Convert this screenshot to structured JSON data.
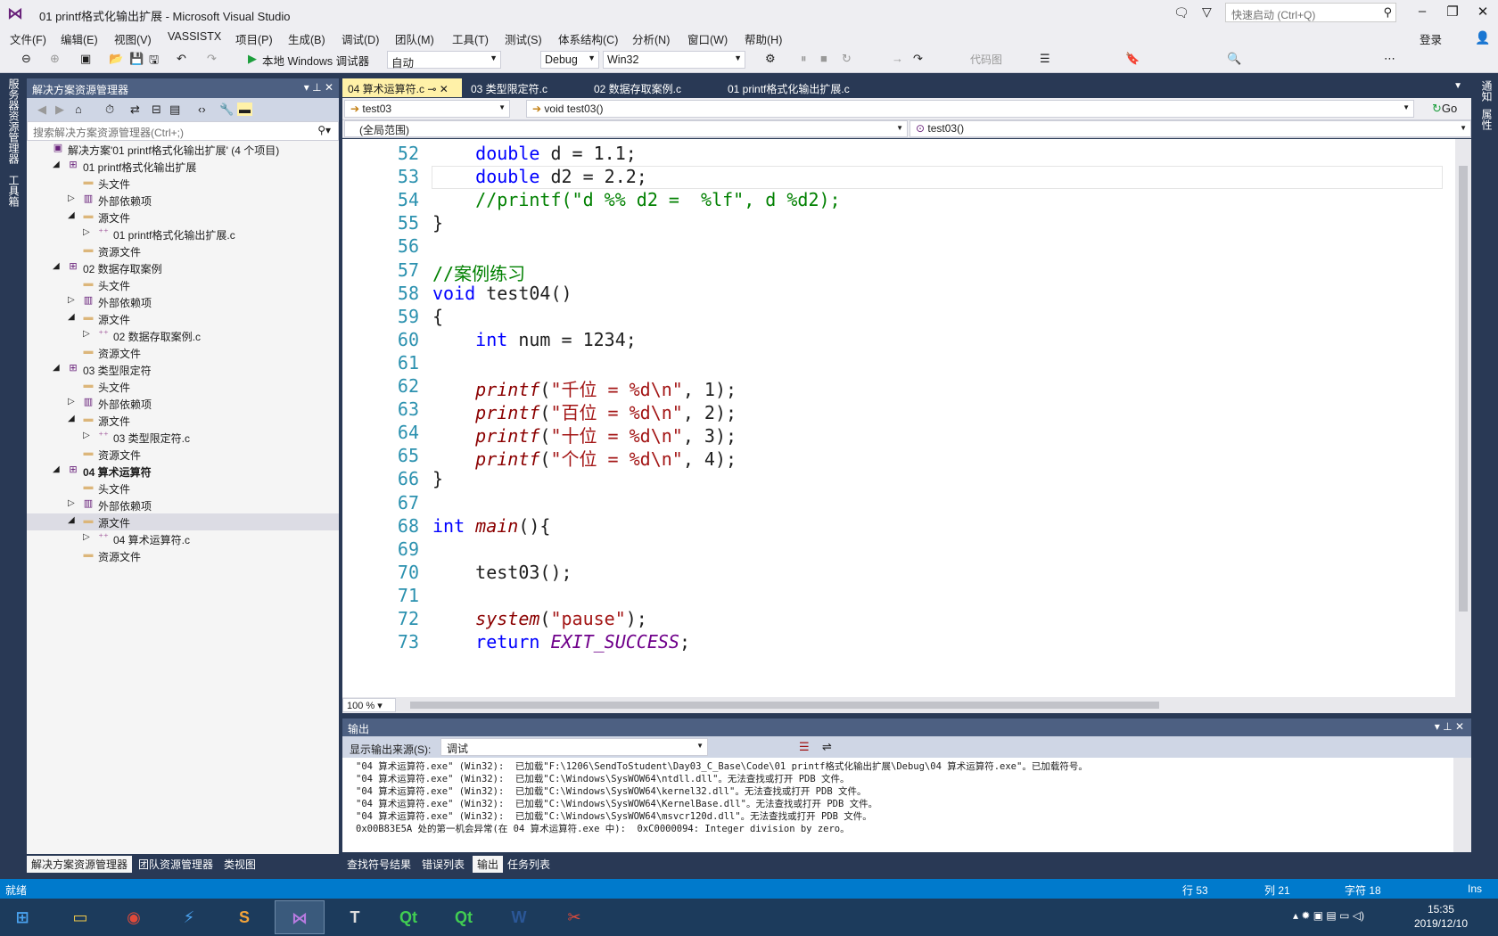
{
  "window": {
    "title": "01 printf格式化输出扩展 - Microsoft Visual Studio",
    "quick_launch": "快速启动 (Ctrl+Q)",
    "sign_in": "登录"
  },
  "menu": [
    "文件(F)",
    "编辑(E)",
    "视图(V)",
    "VASSISTX",
    "项目(P)",
    "生成(B)",
    "调试(D)",
    "团队(M)",
    "工具(T)",
    "测试(S)",
    "体系结构(C)",
    "分析(N)",
    "窗口(W)",
    "帮助(H)"
  ],
  "toolbar": {
    "debugger": "本地 Windows 调试器",
    "auto": "自动",
    "config": "Debug",
    "platform": "Win32",
    "code_map": "代码图"
  },
  "side_tabs_left": [
    "服务器资源管理器",
    "工具箱"
  ],
  "side_tabs_right": [
    "通知",
    "属性"
  ],
  "solution": {
    "header": "解决方案资源管理器",
    "search_placeholder": "搜索解决方案资源管理器(Ctrl+;)",
    "tree": [
      {
        "label": "解决方案'01 printf格式化输出扩展' (4 个项目)",
        "level": 0,
        "icon": "solution-icon",
        "expand": ""
      },
      {
        "label": "01 printf格式化输出扩展",
        "level": 1,
        "icon": "project-icon",
        "expand": "◢"
      },
      {
        "label": "头文件",
        "level": 2,
        "icon": "folder-icon",
        "expand": ""
      },
      {
        "label": "外部依赖项",
        "level": 2,
        "icon": "dependencies-icon",
        "expand": "▷"
      },
      {
        "label": "源文件",
        "level": 2,
        "icon": "folder-icon",
        "expand": "◢"
      },
      {
        "label": "01 printf格式化输出扩展.c",
        "level": 3,
        "icon": "c-file-icon",
        "expand": "▷"
      },
      {
        "label": "资源文件",
        "level": 2,
        "icon": "folder-icon",
        "expand": ""
      },
      {
        "label": "02 数据存取案例",
        "level": 1,
        "icon": "project-icon",
        "expand": "◢"
      },
      {
        "label": "头文件",
        "level": 2,
        "icon": "folder-icon",
        "expand": ""
      },
      {
        "label": "外部依赖项",
        "level": 2,
        "icon": "dependencies-icon",
        "expand": "▷"
      },
      {
        "label": "源文件",
        "level": 2,
        "icon": "folder-icon",
        "expand": "◢"
      },
      {
        "label": "02 数据存取案例.c",
        "level": 3,
        "icon": "c-file-icon",
        "expand": "▷"
      },
      {
        "label": "资源文件",
        "level": 2,
        "icon": "folder-icon",
        "expand": ""
      },
      {
        "label": "03 类型限定符",
        "level": 1,
        "icon": "project-icon",
        "expand": "◢"
      },
      {
        "label": "头文件",
        "level": 2,
        "icon": "folder-icon",
        "expand": ""
      },
      {
        "label": "外部依赖项",
        "level": 2,
        "icon": "dependencies-icon",
        "expand": "▷"
      },
      {
        "label": "源文件",
        "level": 2,
        "icon": "folder-icon",
        "expand": "◢"
      },
      {
        "label": "03 类型限定符.c",
        "level": 3,
        "icon": "c-file-icon",
        "expand": "▷"
      },
      {
        "label": "资源文件",
        "level": 2,
        "icon": "folder-icon",
        "expand": ""
      },
      {
        "label": "04 算术运算符",
        "level": 1,
        "icon": "project-icon",
        "expand": "◢",
        "bold": true
      },
      {
        "label": "头文件",
        "level": 2,
        "icon": "folder-icon",
        "expand": ""
      },
      {
        "label": "外部依赖项",
        "level": 2,
        "icon": "dependencies-icon",
        "expand": "▷"
      },
      {
        "label": "源文件",
        "level": 2,
        "icon": "folder-icon",
        "expand": "◢",
        "selected": true
      },
      {
        "label": "04 算术运算符.c",
        "level": 3,
        "icon": "c-file-icon",
        "expand": "▷"
      },
      {
        "label": "资源文件",
        "level": 2,
        "icon": "folder-icon",
        "expand": ""
      }
    ],
    "bottom_tabs": [
      "解决方案资源管理器",
      "团队资源管理器",
      "类视图"
    ]
  },
  "editor": {
    "tabs": [
      {
        "label": "04 算术运算符.c",
        "active": true
      },
      {
        "label": "03 类型限定符.c",
        "active": false
      },
      {
        "label": "02 数据存取案例.c",
        "active": false
      },
      {
        "label": "01 printf格式化输出扩展.c",
        "active": false
      }
    ],
    "nav_project": "test03",
    "nav_function": "void test03()",
    "go": "Go",
    "scope": "(全局范围)",
    "member": "test03()",
    "zoom": "100 %",
    "lines": [
      {
        "n": "52",
        "parts": [
          [
            "",
            "    "
          ],
          [
            "kw",
            "double"
          ],
          [
            "",
            " d = 1.1;"
          ]
        ]
      },
      {
        "n": "53",
        "parts": [
          [
            "",
            "    "
          ],
          [
            "kw",
            "double"
          ],
          [
            "",
            " d2 = 2.2;"
          ]
        ]
      },
      {
        "n": "54",
        "parts": [
          [
            "",
            "    "
          ],
          [
            "cm",
            "//printf(\"d %% d2 =  %lf\", d %d2);"
          ]
        ]
      },
      {
        "n": "55",
        "parts": [
          [
            "",
            "}"
          ]
        ]
      },
      {
        "n": "56",
        "parts": []
      },
      {
        "n": "57",
        "parts": [
          [
            "cm",
            "//案例练习"
          ]
        ]
      },
      {
        "n": "58",
        "parts": [
          [
            "kw",
            "void"
          ],
          [
            "",
            " test04()"
          ]
        ]
      },
      {
        "n": "59",
        "parts": [
          [
            "",
            "{"
          ]
        ]
      },
      {
        "n": "60",
        "parts": [
          [
            "",
            "    "
          ],
          [
            "kw",
            "int"
          ],
          [
            "",
            " num = 1234;"
          ]
        ]
      },
      {
        "n": "61",
        "parts": []
      },
      {
        "n": "62",
        "parts": [
          [
            "",
            "    "
          ],
          [
            "fn",
            "printf"
          ],
          [
            "",
            "("
          ],
          [
            "st",
            "\"千位 = %d\\n\""
          ],
          [
            "",
            ", 1);"
          ]
        ]
      },
      {
        "n": "63",
        "parts": [
          [
            "",
            "    "
          ],
          [
            "fn",
            "printf"
          ],
          [
            "",
            "("
          ],
          [
            "st",
            "\"百位 = %d\\n\""
          ],
          [
            "",
            ", 2);"
          ]
        ]
      },
      {
        "n": "64",
        "parts": [
          [
            "",
            "    "
          ],
          [
            "fn",
            "printf"
          ],
          [
            "",
            "("
          ],
          [
            "st",
            "\"十位 = %d\\n\""
          ],
          [
            "",
            ", 3);"
          ]
        ]
      },
      {
        "n": "65",
        "parts": [
          [
            "",
            "    "
          ],
          [
            "fn",
            "printf"
          ],
          [
            "",
            "("
          ],
          [
            "st",
            "\"个位 = %d\\n\""
          ],
          [
            "",
            ", 4);"
          ]
        ]
      },
      {
        "n": "66",
        "parts": [
          [
            "",
            "}"
          ]
        ]
      },
      {
        "n": "67",
        "parts": []
      },
      {
        "n": "68",
        "parts": [
          [
            "kw",
            "int"
          ],
          [
            "",
            " "
          ],
          [
            "fn",
            "main"
          ],
          [
            "",
            "(){"
          ]
        ]
      },
      {
        "n": "69",
        "parts": []
      },
      {
        "n": "70",
        "parts": [
          [
            "",
            "    test03();"
          ]
        ]
      },
      {
        "n": "71",
        "parts": []
      },
      {
        "n": "72",
        "parts": [
          [
            "",
            "    "
          ],
          [
            "fn",
            "system"
          ],
          [
            "",
            "("
          ],
          [
            "st",
            "\"pause\""
          ],
          [
            "",
            ");"
          ]
        ]
      },
      {
        "n": "73",
        "parts": [
          [
            "",
            "    "
          ],
          [
            "kw",
            "return"
          ],
          [
            "",
            " "
          ],
          [
            "mc",
            "EXIT_SUCCESS"
          ],
          [
            "",
            ";"
          ]
        ]
      }
    ]
  },
  "output": {
    "header": "输出",
    "source_label": "显示输出来源(S):",
    "source_value": "调试",
    "lines": [
      "\"04 算术运算符.exe\" (Win32):  已加载\"F:\\1206\\SendToStudent\\Day03_C_Base\\Code\\01 printf格式化输出扩展\\Debug\\04 算术运算符.exe\"。已加载符号。",
      "\"04 算术运算符.exe\" (Win32):  已加载\"C:\\Windows\\SysWOW64\\ntdll.dll\"。无法查找或打开 PDB 文件。",
      "\"04 算术运算符.exe\" (Win32):  已加载\"C:\\Windows\\SysWOW64\\kernel32.dll\"。无法查找或打开 PDB 文件。",
      "\"04 算术运算符.exe\" (Win32):  已加载\"C:\\Windows\\SysWOW64\\KernelBase.dll\"。无法查找或打开 PDB 文件。",
      "\"04 算术运算符.exe\" (Win32):  已加载\"C:\\Windows\\SysWOW64\\msvcr120d.dll\"。无法查找或打开 PDB 文件。",
      "0x00B83E5A 处的第一机会异常(在 04 算术运算符.exe 中):  0xC0000094: Integer division by zero。"
    ]
  },
  "bottom_tabs": [
    "查找符号结果",
    "错误列表",
    "输出",
    "任务列表"
  ],
  "status": {
    "ready": "就绪",
    "line": "行 53",
    "col": "列 21",
    "ch": "字符 18",
    "ins": "Ins"
  },
  "taskbar": {
    "apps": [
      "start-button",
      "file-explorer",
      "chrome",
      "thunder",
      "sublime-text",
      "visual-studio",
      "typora",
      "qt-creator",
      "qt-designer",
      "word",
      "snipping-tool"
    ],
    "time": "15:35",
    "date": "2019/12/10"
  }
}
